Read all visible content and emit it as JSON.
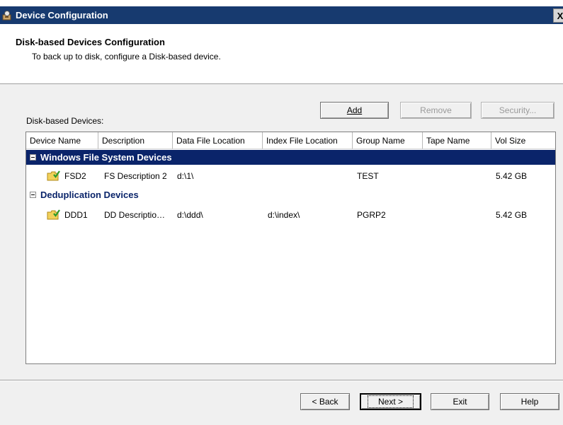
{
  "window": {
    "title": "Device Configuration",
    "close_glyph": "X"
  },
  "header": {
    "title": "Disk-based Devices Configuration",
    "subtitle": "To back up to disk, configure a Disk-based device."
  },
  "devices": {
    "label": "Disk-based Devices:",
    "buttons": {
      "add": "Add",
      "remove": "Remove",
      "security": "Security..."
    },
    "columns": [
      "Device Name",
      "Description",
      "Data File Location",
      "Index File Location",
      "Group Name",
      "Tape Name",
      "Vol Size"
    ],
    "groups": [
      {
        "name": "Windows File System Devices",
        "selected": true,
        "rows": [
          {
            "device_name": "FSD2",
            "description": "FS Description 2",
            "data_file_location": "d:\\1\\",
            "index_file_location": "",
            "group_name": "TEST",
            "tape_name": "",
            "vol_size": "5.42 GB"
          }
        ]
      },
      {
        "name": "Deduplication Devices",
        "selected": false,
        "rows": [
          {
            "device_name": "DDD1",
            "description": "DD Descriptio…",
            "data_file_location": "d:\\ddd\\",
            "index_file_location": "d:\\index\\",
            "group_name": "PGRP2",
            "tape_name": "",
            "vol_size": "5.42 GB"
          }
        ]
      }
    ]
  },
  "footer": {
    "back": "< Back",
    "next": "Next >",
    "exit": "Exit",
    "help": "Help"
  },
  "icons": {
    "app": "device-config-icon",
    "folder": "folder-check-icon",
    "expander": "tree-collapse-icon"
  },
  "colors": {
    "titlebar": "#173a6f",
    "selection": "#0a246a",
    "window_bg": "#f0f0f0"
  }
}
